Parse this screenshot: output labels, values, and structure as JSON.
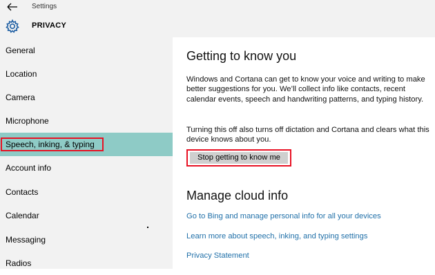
{
  "window": {
    "title": "Settings"
  },
  "header": {
    "title": "PRIVACY"
  },
  "sidebar": {
    "items": [
      {
        "label": "General"
      },
      {
        "label": "Location"
      },
      {
        "label": "Camera"
      },
      {
        "label": "Microphone"
      },
      {
        "label": "Speech, inking, & typing",
        "selected": true
      },
      {
        "label": "Account info"
      },
      {
        "label": "Contacts"
      },
      {
        "label": "Calendar"
      },
      {
        "label": "Messaging"
      },
      {
        "label": "Radios"
      }
    ]
  },
  "main": {
    "section1_title": "Getting to know you",
    "section1_text": "Windows and Cortana can get to know your voice and writing to make better suggestions for you. We’ll collect info like contacts, recent calendar events, speech and handwriting patterns, and typing history.",
    "section1_note": "Turning this off also turns off dictation and Cortana and clears what this device knows about you.",
    "stop_button": "Stop getting to know me",
    "section2_title": "Manage cloud info",
    "links": [
      "Go to Bing and manage personal info for all your devices",
      "Learn more about speech, inking, and typing settings",
      "Privacy Statement"
    ]
  },
  "colors": {
    "accent_selected": "#8ecbc6",
    "highlight_border": "#e81123",
    "link": "#1f6fa8"
  },
  "icons": {
    "back": "arrow-left-icon",
    "settings": "gear-icon"
  }
}
